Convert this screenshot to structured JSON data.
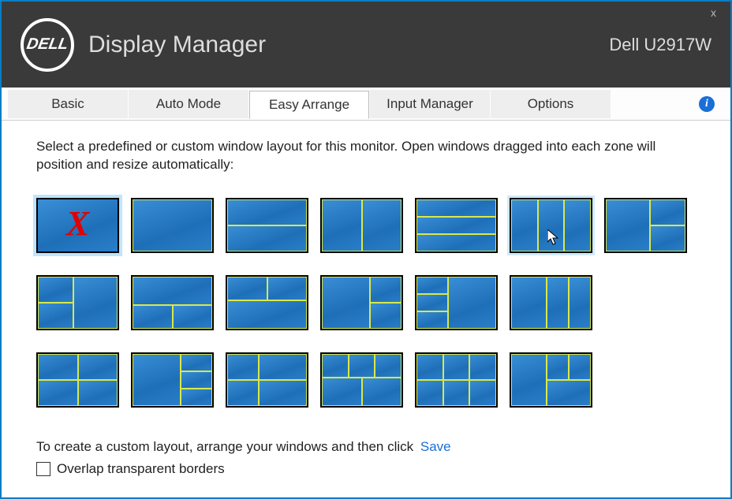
{
  "header": {
    "logo_text": "DELL",
    "app_title": "Display Manager",
    "monitor_name": "Dell U2917W",
    "close_label": "x"
  },
  "tabs": [
    {
      "label": "Basic",
      "active": false
    },
    {
      "label": "Auto Mode",
      "active": false
    },
    {
      "label": "Easy Arrange",
      "active": true
    },
    {
      "label": "Input Manager",
      "active": false
    },
    {
      "label": "Options",
      "active": false
    }
  ],
  "info_icon_glyph": "i",
  "description": "Select a predefined or custom window layout for this monitor.  Open windows dragged into each zone will position and resize automatically:",
  "layouts": [
    {
      "id": "none",
      "selected": true,
      "zones": [
        [
          0,
          0,
          100,
          100
        ]
      ],
      "none": true
    },
    {
      "id": "full",
      "zones": [
        [
          0,
          0,
          100,
          100
        ]
      ]
    },
    {
      "id": "h2",
      "zones": [
        [
          0,
          0,
          100,
          50
        ],
        [
          0,
          50,
          100,
          50
        ]
      ]
    },
    {
      "id": "v2",
      "zones": [
        [
          0,
          0,
          50,
          100
        ],
        [
          50,
          0,
          50,
          100
        ]
      ]
    },
    {
      "id": "h3",
      "zones": [
        [
          0,
          0,
          100,
          33.3
        ],
        [
          0,
          33.3,
          100,
          33.3
        ],
        [
          0,
          66.6,
          100,
          33.4
        ]
      ]
    },
    {
      "id": "v3",
      "hovered": true,
      "zones": [
        [
          0,
          0,
          33.3,
          100
        ],
        [
          33.3,
          0,
          33.3,
          100
        ],
        [
          66.6,
          0,
          33.4,
          100
        ]
      ]
    },
    {
      "id": "bigleft-2right",
      "zones": [
        [
          0,
          0,
          55,
          100
        ],
        [
          55,
          0,
          45,
          50
        ],
        [
          55,
          50,
          45,
          50
        ]
      ]
    },
    {
      "id": "2left-bigright",
      "zones": [
        [
          0,
          0,
          45,
          50
        ],
        [
          0,
          50,
          45,
          50
        ],
        [
          45,
          0,
          55,
          100
        ]
      ]
    },
    {
      "id": "bigtop-2bottom",
      "zones": [
        [
          0,
          0,
          100,
          55
        ],
        [
          0,
          55,
          50,
          45
        ],
        [
          50,
          55,
          50,
          45
        ]
      ]
    },
    {
      "id": "2top-bigbottom",
      "zones": [
        [
          0,
          0,
          50,
          45
        ],
        [
          50,
          0,
          50,
          45
        ],
        [
          0,
          45,
          100,
          55
        ]
      ]
    },
    {
      "id": "bigleft-2right-b",
      "zones": [
        [
          0,
          0,
          60,
          100
        ],
        [
          60,
          0,
          40,
          50
        ],
        [
          60,
          50,
          40,
          50
        ]
      ]
    },
    {
      "id": "3left-bigright",
      "zones": [
        [
          0,
          0,
          40,
          33.3
        ],
        [
          0,
          33.3,
          40,
          33.3
        ],
        [
          0,
          66.6,
          40,
          33.4
        ],
        [
          40,
          0,
          60,
          100
        ]
      ]
    },
    {
      "id": "v3-wideleft",
      "zones": [
        [
          0,
          0,
          45,
          100
        ],
        [
          45,
          0,
          27.5,
          100
        ],
        [
          72.5,
          0,
          27.5,
          100
        ]
      ]
    },
    {
      "id": "placeholder-14",
      "zones": []
    },
    {
      "id": "quad",
      "zones": [
        [
          0,
          0,
          50,
          50
        ],
        [
          50,
          0,
          50,
          50
        ],
        [
          0,
          50,
          50,
          50
        ],
        [
          50,
          50,
          50,
          50
        ]
      ]
    },
    {
      "id": "bigleft-3right",
      "zones": [
        [
          0,
          0,
          60,
          100
        ],
        [
          60,
          0,
          40,
          33.3
        ],
        [
          60,
          33.3,
          40,
          33.3
        ],
        [
          60,
          66.6,
          40,
          33.4
        ]
      ]
    },
    {
      "id": "quad-tall-left",
      "zones": [
        [
          0,
          0,
          40,
          50
        ],
        [
          40,
          0,
          60,
          50
        ],
        [
          0,
          50,
          40,
          50
        ],
        [
          40,
          50,
          60,
          50
        ]
      ]
    },
    {
      "id": "3top-2bottom",
      "zones": [
        [
          0,
          0,
          33.3,
          45
        ],
        [
          33.3,
          0,
          33.3,
          45
        ],
        [
          66.6,
          0,
          33.4,
          45
        ],
        [
          0,
          45,
          50,
          55
        ],
        [
          50,
          45,
          50,
          55
        ]
      ]
    },
    {
      "id": "2x3",
      "zones": [
        [
          0,
          0,
          33.3,
          50
        ],
        [
          33.3,
          0,
          33.3,
          50
        ],
        [
          66.6,
          0,
          33.4,
          50
        ],
        [
          0,
          50,
          33.3,
          50
        ],
        [
          33.3,
          50,
          33.3,
          50
        ],
        [
          66.6,
          50,
          33.4,
          50
        ]
      ]
    },
    {
      "id": "bigleft-2top-1bottom",
      "zones": [
        [
          0,
          0,
          45,
          100
        ],
        [
          45,
          0,
          27.5,
          50
        ],
        [
          72.5,
          0,
          27.5,
          50
        ],
        [
          45,
          50,
          55,
          50
        ]
      ]
    }
  ],
  "footer": {
    "custom_text": "To create a custom layout, arrange your windows and then click",
    "save_label": "Save",
    "overlap_label": "Overlap transparent borders",
    "overlap_checked": false
  }
}
